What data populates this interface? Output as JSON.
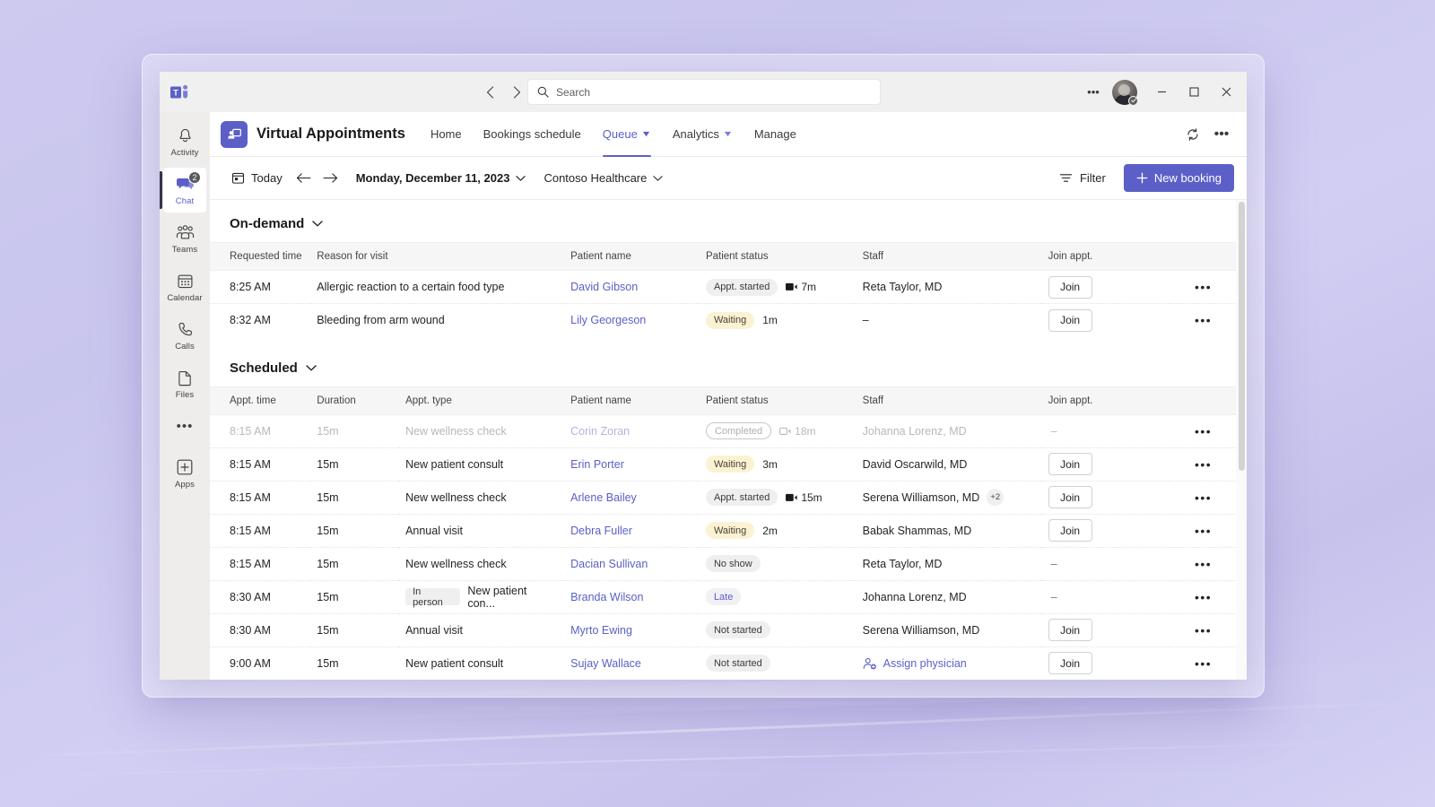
{
  "titlebar": {
    "logo_icon": "teams-logo-icon",
    "back_icon": "chevron-left-icon",
    "forward_icon": "chevron-right-icon",
    "search_placeholder": "Search",
    "search_value": "",
    "search_icon": "search-icon",
    "more_icon": "ellipsis-icon",
    "avatar_name": "avatar",
    "minimize_label": "—",
    "maximize_label": "□",
    "close_label": "✕"
  },
  "rail": {
    "items": [
      {
        "label": "Activity",
        "icon": "bell-icon",
        "active": false,
        "badge": ""
      },
      {
        "label": "Chat",
        "icon": "chat-icon",
        "active": true,
        "badge": "2"
      },
      {
        "label": "Teams",
        "icon": "people-icon",
        "active": false,
        "badge": ""
      },
      {
        "label": "Calendar",
        "icon": "calendar-icon",
        "active": false,
        "badge": ""
      },
      {
        "label": "Calls",
        "icon": "phone-icon",
        "active": false,
        "badge": ""
      },
      {
        "label": "Files",
        "icon": "file-icon",
        "active": false,
        "badge": ""
      }
    ],
    "more_icon": "ellipsis-icon",
    "apps_label": "Apps",
    "apps_icon": "apps-plus-icon"
  },
  "apphead": {
    "app_icon": "virtual-appointments-icon",
    "title": "Virtual Appointments",
    "tabs": [
      {
        "label": "Home",
        "active": false,
        "dropdown": false
      },
      {
        "label": "Bookings schedule",
        "active": false,
        "dropdown": false
      },
      {
        "label": "Queue",
        "active": true,
        "dropdown": true
      },
      {
        "label": "Analytics",
        "active": false,
        "dropdown": true
      },
      {
        "label": "Manage",
        "active": false,
        "dropdown": false
      }
    ],
    "refresh_icon": "refresh-icon",
    "more_icon": "ellipsis-icon"
  },
  "toolbar": {
    "today_label": "Today",
    "today_icon": "today-calendar-icon",
    "prev_icon": "arrow-left-icon",
    "next_icon": "arrow-right-icon",
    "date_label": "Monday, December 11, 2023",
    "org_label": "Contoso Healthcare",
    "filter_label": "Filter",
    "filter_icon": "filter-icon",
    "new_booking_label": "New booking",
    "new_booking_icon": "plus-icon",
    "accent_color": "#5b5fc7"
  },
  "sections": {
    "ondemand": {
      "title": "On-demand",
      "columns": [
        "Requested time",
        "Reason for visit",
        "Patient name",
        "Patient status",
        "Staff",
        "Join appt.",
        ""
      ],
      "rows": [
        {
          "time": "8:25 AM",
          "reason": "Allergic reaction to a certain food type",
          "patient": "David Gibson",
          "status": "Appt. started",
          "status_style": "grey",
          "duration": "7m",
          "duration_icon": "video-filled-icon",
          "staff": "Reta Taylor, MD",
          "join": "Join",
          "more": "•••"
        },
        {
          "time": "8:32 AM",
          "reason": "Bleeding from arm wound",
          "patient": "Lily Georgeson",
          "status": "Waiting",
          "status_style": "yellow",
          "duration": "1m",
          "duration_icon": "",
          "staff": "–",
          "join": "Join",
          "more": "•••"
        }
      ]
    },
    "scheduled": {
      "title": "Scheduled",
      "columns": [
        "Appt. time",
        "Duration",
        "Appt. type",
        "Patient name",
        "Patient status",
        "Staff",
        "Join appt.",
        ""
      ],
      "rows": [
        {
          "time": "8:15 AM",
          "dur": "15m",
          "tag": "",
          "type": "New wellness check",
          "patient": "Corin Zoran",
          "status": "Completed",
          "status_style": "outline",
          "duration": "18m",
          "duration_icon": "video-off-icon",
          "staff": "Johanna Lorenz, MD",
          "staff_extra": "",
          "join": "",
          "join_dash": "–",
          "dimmed": true,
          "more": "•••"
        },
        {
          "time": "8:15 AM",
          "dur": "15m",
          "tag": "",
          "type": "New patient consult",
          "patient": "Erin Porter",
          "status": "Waiting",
          "status_style": "yellow",
          "duration": "3m",
          "duration_icon": "",
          "staff": "David Oscarwild, MD",
          "staff_extra": "",
          "join": "Join",
          "join_dash": "",
          "dimmed": false,
          "more": "•••"
        },
        {
          "time": "8:15 AM",
          "dur": "15m",
          "tag": "",
          "type": "New wellness check",
          "patient": "Arlene Bailey",
          "status": "Appt. started",
          "status_style": "grey",
          "duration": "15m",
          "duration_icon": "video-filled-icon",
          "staff": "Serena Williamson, MD",
          "staff_extra": "+2",
          "join": "Join",
          "join_dash": "",
          "dimmed": false,
          "more": "•••"
        },
        {
          "time": "8:15 AM",
          "dur": "15m",
          "tag": "",
          "type": "Annual visit",
          "patient": "Debra Fuller",
          "status": "Waiting",
          "status_style": "yellow",
          "duration": "2m",
          "duration_icon": "",
          "staff": "Babak Shammas, MD",
          "staff_extra": "",
          "join": "Join",
          "join_dash": "",
          "dimmed": false,
          "more": "•••"
        },
        {
          "time": "8:15 AM",
          "dur": "15m",
          "tag": "",
          "type": "New wellness check",
          "patient": "Dacian Sullivan",
          "status": "No show",
          "status_style": "grey",
          "duration": "",
          "duration_icon": "",
          "staff": "Reta Taylor, MD",
          "staff_extra": "",
          "join": "",
          "join_dash": "–",
          "dimmed": false,
          "more": "•••"
        },
        {
          "time": "8:30 AM",
          "dur": "15m",
          "tag": "In person",
          "type": "New patient con...",
          "patient": "Branda Wilson",
          "status": "Late",
          "status_style": "late",
          "duration": "",
          "duration_icon": "",
          "staff": "Johanna Lorenz, MD",
          "staff_extra": "",
          "join": "",
          "join_dash": "–",
          "dimmed": false,
          "more": "•••"
        },
        {
          "time": "8:30 AM",
          "dur": "15m",
          "tag": "",
          "type": "Annual visit",
          "patient": "Myrto Ewing",
          "status": "Not started",
          "status_style": "grey",
          "duration": "",
          "duration_icon": "",
          "staff": "Serena Williamson, MD",
          "staff_extra": "",
          "join": "Join",
          "join_dash": "",
          "dimmed": false,
          "more": "•••"
        },
        {
          "time": "9:00 AM",
          "dur": "15m",
          "tag": "",
          "type": "New patient consult",
          "patient": "Sujay Wallace",
          "status": "Not started",
          "status_style": "grey",
          "duration": "",
          "duration_icon": "",
          "staff": "Assign physician",
          "staff_assign": true,
          "staff_extra": "",
          "join": "Join",
          "join_dash": "",
          "dimmed": false,
          "more": "•••"
        }
      ]
    }
  }
}
